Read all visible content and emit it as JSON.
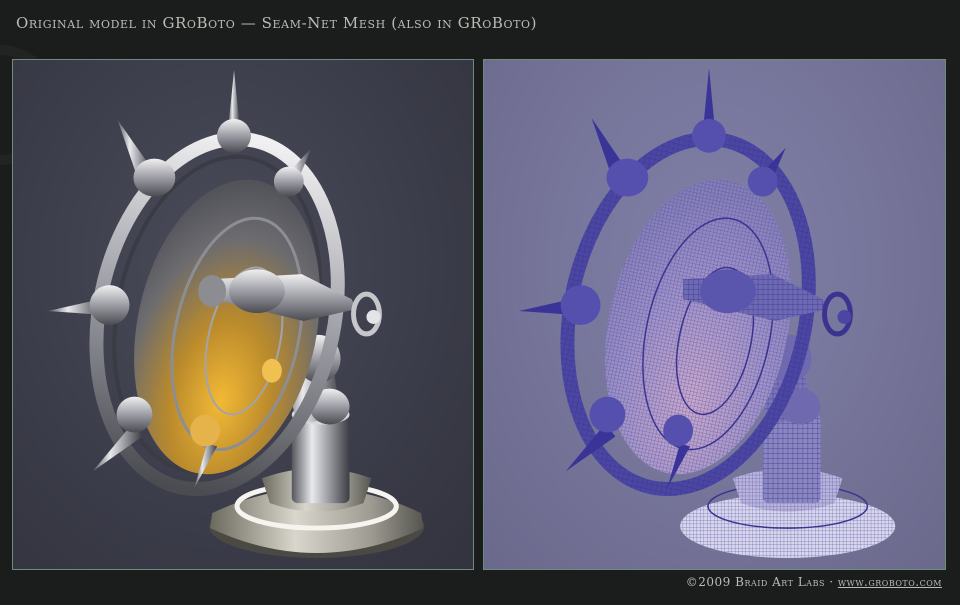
{
  "header": {
    "title": "Original model in GRoBoto — Seam-Net Mesh (also in GRoBoto)"
  },
  "footer": {
    "copyright": "©2009 Braid Art Labs · ",
    "link": "www.groboto.com"
  },
  "colors": {
    "background": "#1b1c1c",
    "panel_border": "#6f8b7a",
    "left_panel_bg": "#3b3c49",
    "right_panel_bg": "#747397",
    "mesh_stroke": "#3a3490",
    "chrome": "#c9cacd",
    "gold_glow": "#e0a526",
    "text": "#b9bdb6"
  },
  "panels": [
    {
      "id": "render",
      "icon": "spiked-wheel-robot-render"
    },
    {
      "id": "mesh",
      "icon": "spiked-wheel-robot-wireframe"
    }
  ]
}
